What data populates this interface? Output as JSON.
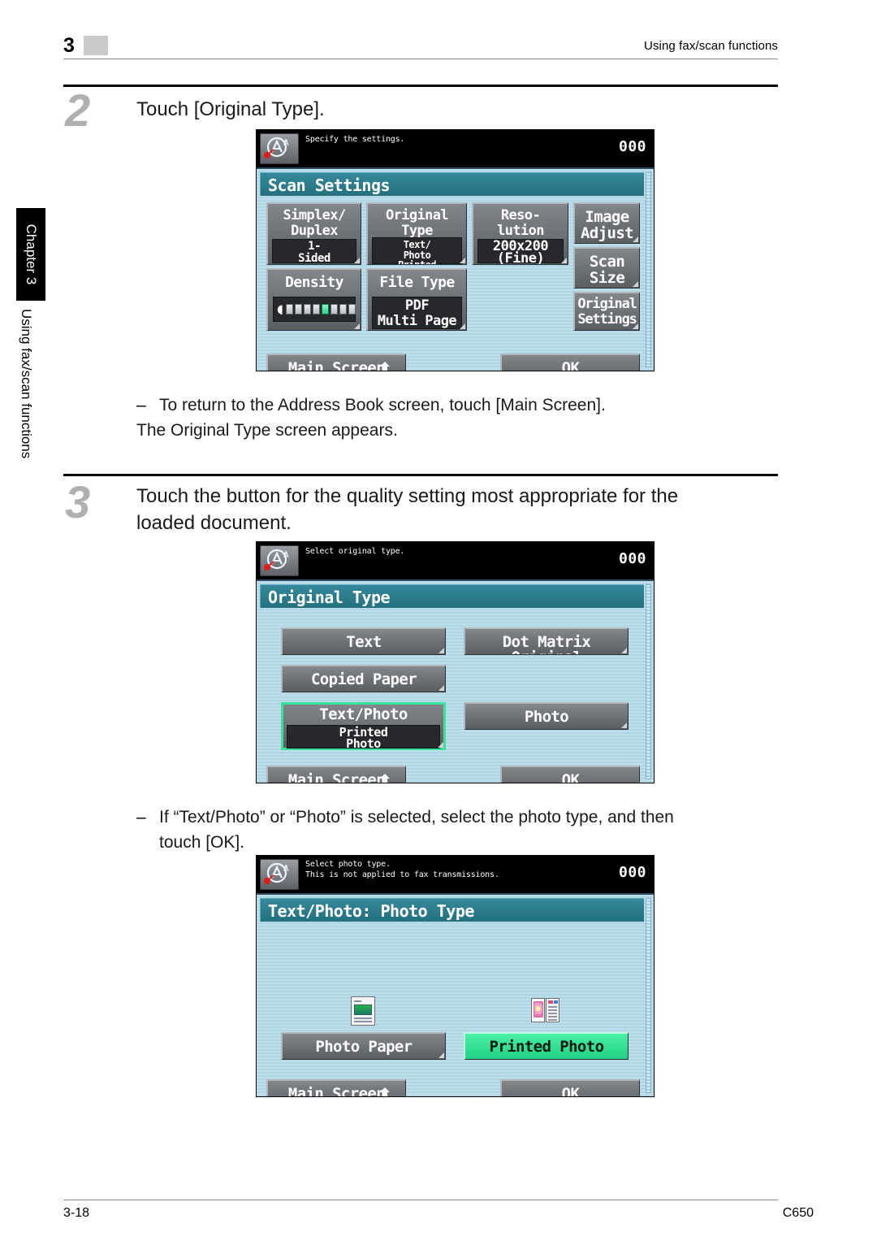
{
  "header": {
    "chapter_number": "3",
    "title": "Using fax/scan functions"
  },
  "sidebar": {
    "tab_label": "Chapter 3",
    "section_label": "Using fax/scan functions"
  },
  "footer": {
    "page_number": "3-18",
    "model": "C650"
  },
  "colors": {
    "lcd_titlebar": "#2b8596",
    "lcd_background": "#b0d8e6",
    "button_face": "#6e7175",
    "selection_green": "#2fd58c",
    "step_number_gray": "#b0b0b0"
  },
  "steps": [
    {
      "number": "2",
      "text": "Touch [Original Type].",
      "notes": [
        "To return to the Address Book screen, touch [Main Screen].",
        "The Original Type screen appears."
      ]
    },
    {
      "number": "3",
      "text": "Touch the button for the quality setting most appropriate for the loaded document.",
      "line1": "Touch the button for the quality setting most appropriate for the",
      "line2": "loaded document.",
      "notes": [
        "If “Text/Photo” or “Photo” is selected, select the photo type, and then",
        "touch [OK]."
      ]
    }
  ],
  "screens": [
    {
      "name": "scan-settings",
      "status_message": "Specify the settings.",
      "counter": "000",
      "status_icon": "fax-scan-mode-icon",
      "title": "Scan Settings",
      "buttons": [
        {
          "label": "Simplex/\nDuplex",
          "value": "1-\nSided",
          "selected": false
        },
        {
          "label": "Original\nType",
          "value": "Text/\nPhoto\nPrinted\nPhoto",
          "selected": false
        },
        {
          "label": "Reso-\nlution",
          "value": "200x200\n(Fine)",
          "selected": false
        },
        {
          "label": "Density",
          "value": "",
          "selected": false
        },
        {
          "label": "File Type",
          "value": "PDF\nMulti Page",
          "selected": false
        }
      ],
      "side_buttons": [
        {
          "label": "Image\nAdjust"
        },
        {
          "label": "Scan\nSize"
        },
        {
          "label": "Original\nSettings"
        }
      ],
      "density": {
        "segments": 9,
        "selected_index": 5
      },
      "main_screen_label": "Main Screen",
      "ok_label": "OK"
    },
    {
      "name": "original-type",
      "status_message": "Select original type.",
      "counter": "000",
      "status_icon": "fax-scan-mode-icon",
      "title": "Original Type",
      "buttons": [
        {
          "label": "Text",
          "selected": false
        },
        {
          "label": "Dot Matrix Original",
          "selected": false
        },
        {
          "label": "Copied Paper",
          "selected": false
        },
        {
          "label": "Text/Photo",
          "value": "Printed\nPhoto",
          "selected": true
        },
        {
          "label": "Photo",
          "selected": false
        }
      ],
      "main_screen_label": "Main Screen",
      "ok_label": "OK"
    },
    {
      "name": "photo-type",
      "status_message": "Select photo type.\nThis is not applied to fax transmissions.",
      "status_message_line1": "Select photo type.",
      "status_message_line2": "This is not applied to fax transmissions.",
      "counter": "000",
      "status_icon": "fax-scan-mode-icon",
      "title": "Text/Photo: Photo Type",
      "buttons": [
        {
          "label": "Photo Paper",
          "icon": "photo-document-icon",
          "selected": false
        },
        {
          "label": "Printed Photo",
          "icon": "open-book-icon",
          "selected": true
        }
      ],
      "main_screen_label": "Main Screen",
      "ok_label": "OK"
    }
  ]
}
